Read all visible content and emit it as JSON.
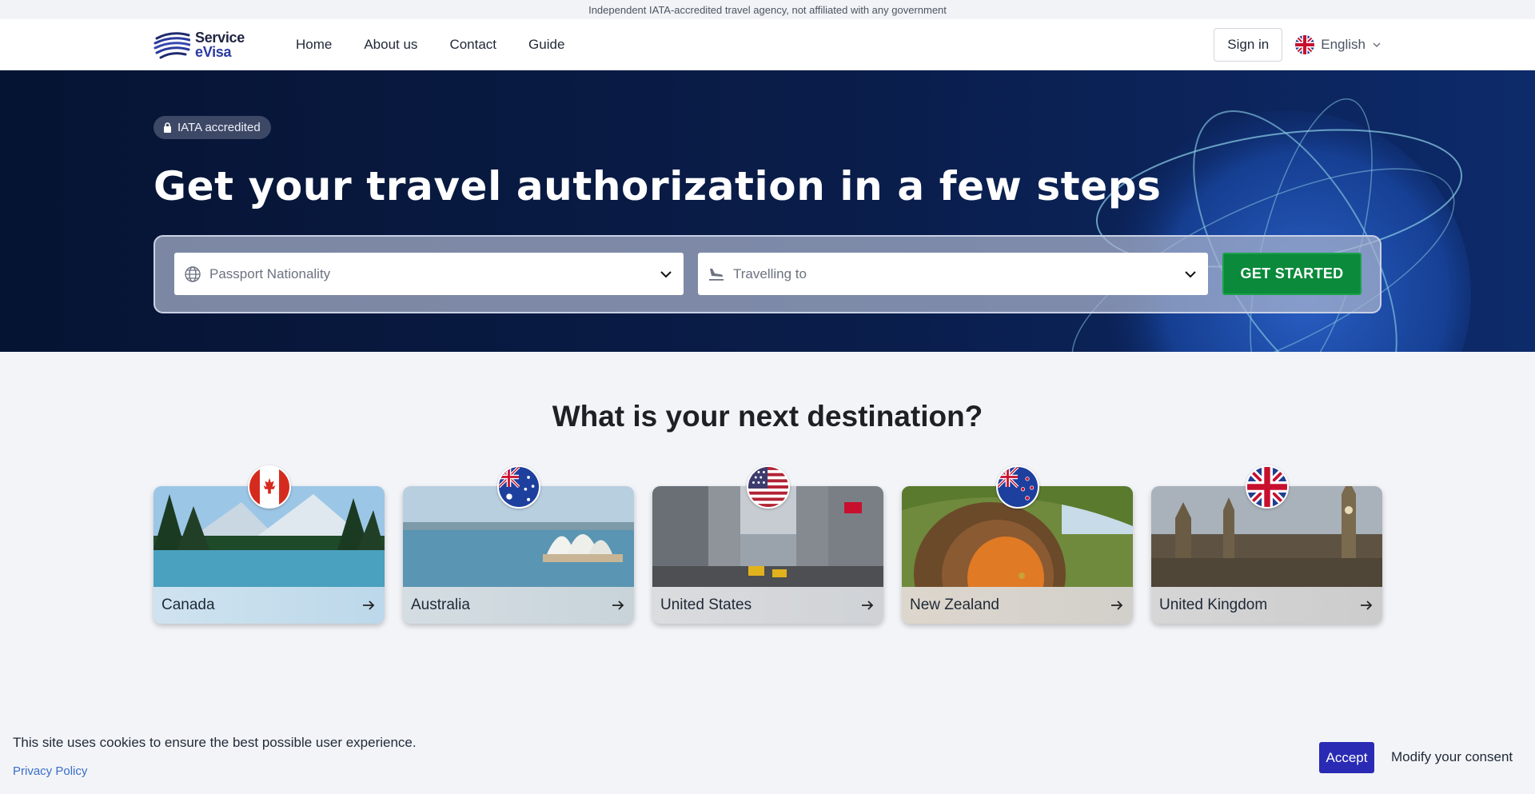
{
  "topbar": {
    "notice": "Independent IATA-accredited travel agency, not affiliated with any government"
  },
  "header": {
    "logo_line1": "Service",
    "logo_line2": "eVisa",
    "nav": [
      "Home",
      "About us",
      "Contact",
      "Guide"
    ],
    "signin_label": "Sign in",
    "language_label": "English"
  },
  "hero": {
    "badge": "IATA accredited",
    "title": "Get your travel authorization in a few steps",
    "nationality_placeholder": "Passport Nationality",
    "destination_placeholder": "Travelling to",
    "cta_label": "GET STARTED"
  },
  "destinations": {
    "title": "What is your next destination?",
    "items": [
      {
        "name": "Canada",
        "flag": "canada-flag-icon"
      },
      {
        "name": "Australia",
        "flag": "australia-flag-icon"
      },
      {
        "name": "United States",
        "flag": "usa-flag-icon"
      },
      {
        "name": "New Zealand",
        "flag": "new-zealand-flag-icon"
      },
      {
        "name": "United Kingdom",
        "flag": "uk-flag-icon"
      }
    ]
  },
  "cookie": {
    "message": "This site uses cookies to ensure the best possible user experience.",
    "privacy_link": "Privacy Policy",
    "accept_label": "Accept",
    "modify_label": "Modify your consent"
  },
  "colors": {
    "hero_bg": "#061433",
    "cta_green": "#0a8a3a",
    "accept_blue": "#2a2ab5",
    "link_blue": "#3a6ec7"
  }
}
